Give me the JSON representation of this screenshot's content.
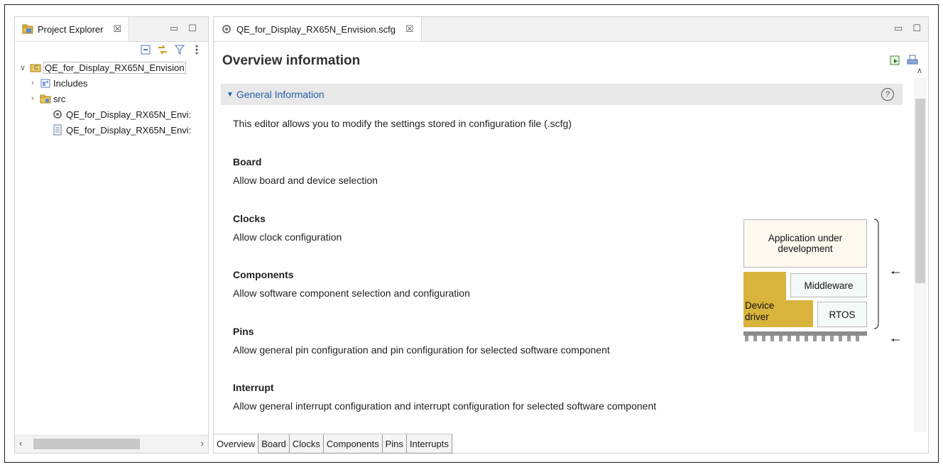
{
  "project_explorer": {
    "tab_label": "Project Explorer",
    "tree": [
      {
        "label": "QE_for_Display_RX65N_Envision",
        "expanded": true
      },
      {
        "label": "Includes"
      },
      {
        "label": "src"
      },
      {
        "label": "QE_for_Display_RX65N_Envi:"
      },
      {
        "label": "QE_for_Display_RX65N_Envi:"
      }
    ]
  },
  "editor": {
    "tab_label": "QE_for_Display_RX65N_Envision.scfg",
    "title": "Overview information",
    "section_label": "General Information",
    "intro": "This editor allows you to modify the settings stored in configuration file (.scfg)",
    "sections": [
      {
        "heading": "Board",
        "desc": "Allow board and device selection"
      },
      {
        "heading": "Clocks",
        "desc": "Allow clock configuration"
      },
      {
        "heading": "Components",
        "desc": "Allow software component selection and configuration"
      },
      {
        "heading": "Pins",
        "desc": "Allow general pin configuration and pin configuration for selected software component"
      },
      {
        "heading": "Interrupt",
        "desc": "Allow general interrupt configuration and interrupt configuration for selected software component"
      }
    ],
    "diagram": {
      "application": "Application under development",
      "middleware": "Middleware",
      "device_driver": "Device driver",
      "rtos": "RTOS"
    },
    "bottom_tabs": [
      "Overview",
      "Board",
      "Clocks",
      "Components",
      "Pins",
      "Interrupts"
    ],
    "active_bottom_tab": "Overview"
  },
  "colors": {
    "section_label": "#1f5fa8",
    "app_box": "#fdf9ef",
    "device_driver": "#d9b43c",
    "module_box": "#f3faf7"
  }
}
